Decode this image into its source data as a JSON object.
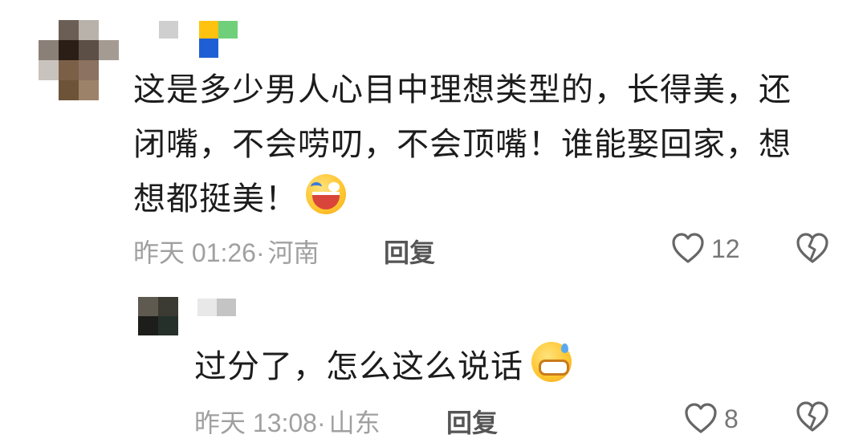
{
  "comments": [
    {
      "text_line1": "这是多少男人心目中理想类型的，长得美，还",
      "text_line2": "闭嘴，不会唠叨，不会顶嘴！谁能娶回家，想",
      "text_line3": "想都挺美！",
      "emoji": "laugh-crying-emoji",
      "time": "昨天 01:26",
      "location_sep": "·",
      "location": "河南",
      "reply_label": "回复",
      "like_count": "12",
      "colors": {
        "meta": "#a0a0a0"
      }
    }
  ],
  "reply": {
    "text": "过分了，怎么这么说话",
    "emoji": "grinning-sweat-emoji",
    "time": "昨天 13:08",
    "location_sep": "·",
    "location": "山东",
    "reply_label": "回复",
    "like_count": "8"
  }
}
